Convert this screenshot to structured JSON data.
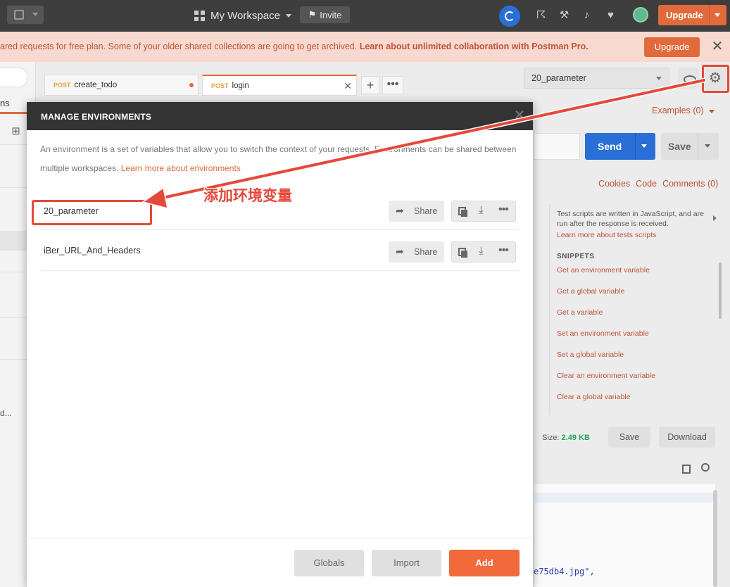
{
  "topbar": {
    "workspace": "My Workspace",
    "invite": "Invite",
    "upgrade": "Upgrade"
  },
  "banner": {
    "text": "ared requests for free plan. Some of your older shared collections are going to get archived. ",
    "link": "Learn about unlimited collaboration with Postman Pro.",
    "upgrade": "Upgrade",
    "close": "✕"
  },
  "sidebar": {
    "tab": "ns",
    "truncated": "d..."
  },
  "tabs": [
    {
      "method": "POST",
      "name": "create_todo"
    },
    {
      "method": "POST",
      "name": "login"
    }
  ],
  "env_selector": {
    "value": "20_parameter"
  },
  "request": {
    "examples": "Examples (0)",
    "send": "Send",
    "save": "Save",
    "links": [
      "Cookies",
      "Code",
      "Comments (0)"
    ]
  },
  "snippets": {
    "info": "Test scripts are written in JavaScript, and are run after the response is received.",
    "learn": "Learn more about tests scripts",
    "title": "SNIPPETS",
    "items": [
      "Get an environment variable",
      "Get a global variable",
      "Get a variable",
      "Set an environment variable",
      "Set a global variable",
      "Clear an environment variable",
      "Clear a global variable"
    ]
  },
  "response": {
    "size_label": "Size:",
    "size_value": "2.49 KB",
    "save": "Save",
    "download": "Download",
    "code": "e75db4.jpg\","
  },
  "modal": {
    "title": "MANAGE ENVIRONMENTS",
    "desc": "An environment is a set of variables that allow you to switch the context of your requests. Environments can be shared between multiple workspaces. ",
    "desc_link": "Learn more about environments",
    "environments": [
      {
        "name": "20_parameter",
        "share": "Share"
      },
      {
        "name": "iBer_URL_And_Headers",
        "share": "Share"
      }
    ],
    "globals": "Globals",
    "import": "Import",
    "add": "Add"
  },
  "annotation": {
    "text": "添加环境变量",
    "color": "#e5493a"
  }
}
